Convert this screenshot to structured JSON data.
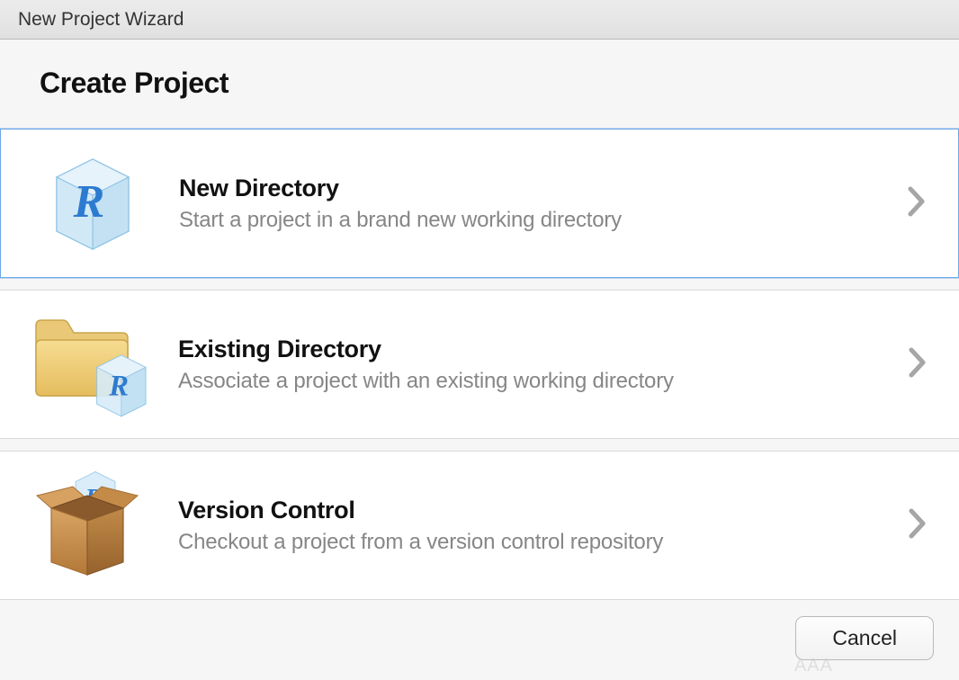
{
  "window": {
    "title": "New Project Wizard"
  },
  "header": {
    "title": "Create Project"
  },
  "options": [
    {
      "id": "new-directory",
      "title": "New Directory",
      "description": "Start a project in a brand new working directory",
      "selected": true
    },
    {
      "id": "existing-directory",
      "title": "Existing Directory",
      "description": "Associate a project with an existing working directory",
      "selected": false
    },
    {
      "id": "version-control",
      "title": "Version Control",
      "description": "Checkout a project from a version control repository",
      "selected": false
    }
  ],
  "footer": {
    "cancel_label": "Cancel"
  },
  "watermark": "AAA"
}
